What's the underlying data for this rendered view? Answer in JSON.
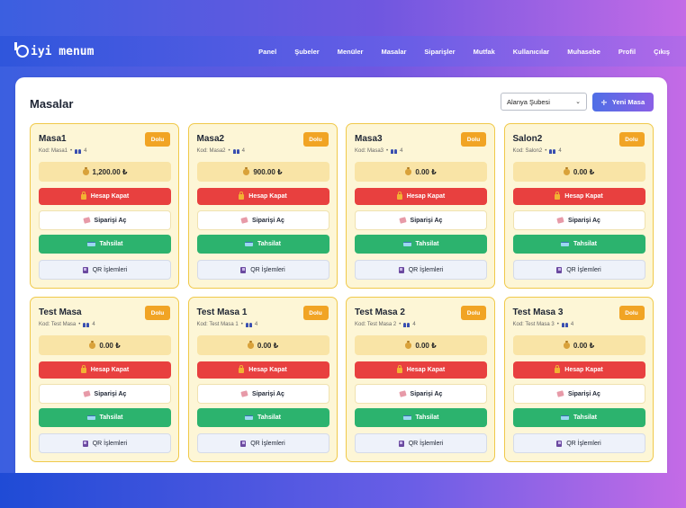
{
  "app": {
    "logo_text": "iyi menum"
  },
  "nav": {
    "items": [
      "Panel",
      "Şubeler",
      "Menüler",
      "Masalar",
      "Siparişler",
      "Mutfak",
      "Kullanıcılar",
      "Muhasebe",
      "Profil",
      "Çıkış"
    ]
  },
  "page": {
    "title": "Masalar",
    "branch_selected": "Alanya Şubesi",
    "new_table_label": "Yeni Masa"
  },
  "labels": {
    "close_bill": "Hesap Kapat",
    "open_order": "Siparişi Aç",
    "collect": "Tahsilat",
    "qr": "QR İşlemleri"
  },
  "colors": {
    "status_busy": "#f1a424",
    "close_bill": "#e8403f",
    "collect": "#2cb36e",
    "card_bg": "#fdf6d6",
    "card_border": "#f0c94a"
  },
  "tables": [
    {
      "name": "Masa1",
      "code": "Kod: Masa1",
      "capacity": "4",
      "status": "Dolu",
      "amount": "1,200.00 ₺"
    },
    {
      "name": "Masa2",
      "code": "Kod: Masa2",
      "capacity": "4",
      "status": "Dolu",
      "amount": "900.00 ₺"
    },
    {
      "name": "Masa3",
      "code": "Kod: Masa3",
      "capacity": "4",
      "status": "Dolu",
      "amount": "0.00 ₺"
    },
    {
      "name": "Salon2",
      "code": "Kod: Salon2",
      "capacity": "4",
      "status": "Dolu",
      "amount": "0.00 ₺"
    },
    {
      "name": "Test Masa",
      "code": "Kod: Test Masa",
      "capacity": "4",
      "status": "Dolu",
      "amount": "0.00 ₺"
    },
    {
      "name": "Test Masa 1",
      "code": "Kod: Test Masa 1",
      "capacity": "4",
      "status": "Dolu",
      "amount": "0.00 ₺"
    },
    {
      "name": "Test Masa 2",
      "code": "Kod: Test Masa 2",
      "capacity": "4",
      "status": "Dolu",
      "amount": "0.00 ₺"
    },
    {
      "name": "Test Masa 3",
      "code": "Kod: Test Masa 3",
      "capacity": "4",
      "status": "Dolu",
      "amount": "0.00 ₺"
    }
  ]
}
